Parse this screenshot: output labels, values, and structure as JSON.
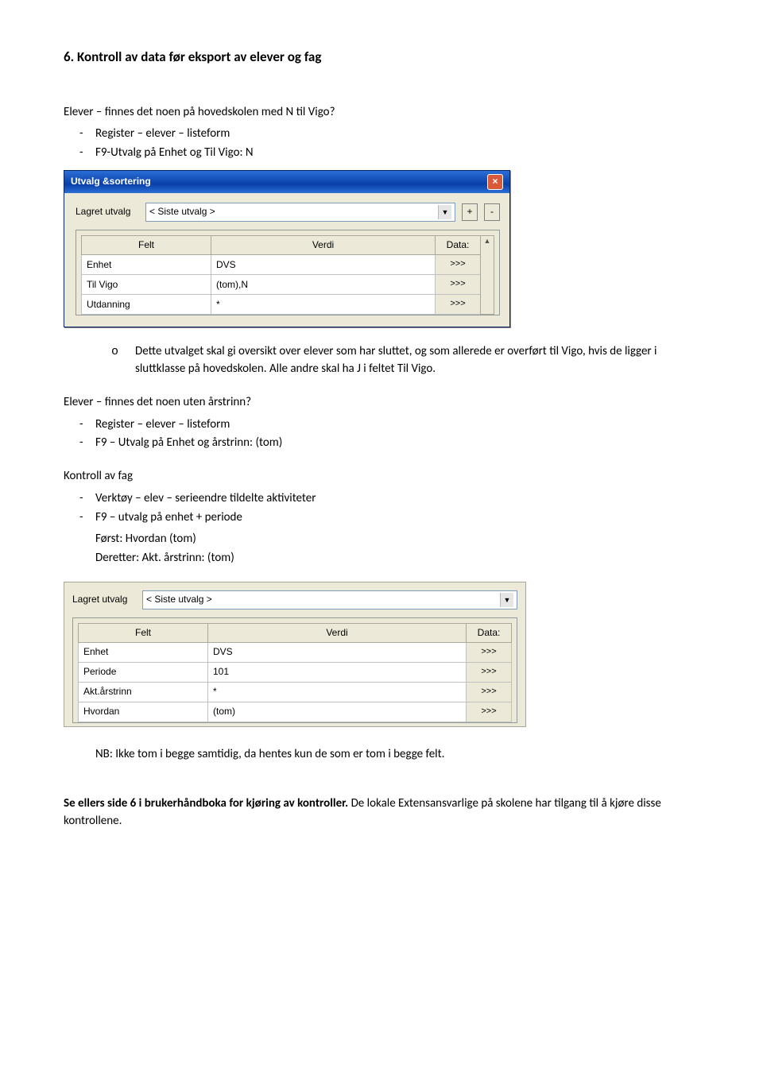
{
  "heading": "6. Kontroll av data før eksport av elever og fag",
  "sec1": {
    "intro": "Elever – finnes det noen på hovedskolen med N til Vigo?",
    "b1": "Register – elever – listeform",
    "b2": "F9-Utvalg på Enhet og Til Vigo: N",
    "sub": "Dette utvalget skal gi oversikt over elever som har sluttet, og som allerede er overført til Vigo, hvis de ligger i sluttklasse på hovedskolen. Alle andre skal ha J i feltet Til Vigo."
  },
  "dlg1": {
    "title": "Utvalg &sortering",
    "close": "×",
    "lagret_label": "Lagret utvalg",
    "lagret_value": "< Siste utvalg >",
    "plus": "+",
    "minus": "-",
    "cols": {
      "felt": "Felt",
      "verdi": "Verdi",
      "data": "Data:"
    },
    "angles": ">>>",
    "rows": [
      {
        "felt": "Enhet",
        "verdi": "DVS"
      },
      {
        "felt": "Til Vigo",
        "verdi": "(tom),N"
      },
      {
        "felt": "Utdanning",
        "verdi": "*"
      }
    ],
    "scroll_up": "▲"
  },
  "sec2": {
    "intro": "Elever – finnes det noen uten årstrinn?",
    "b1": "Register – elever – listeform",
    "b2": "F9 – Utvalg på Enhet og årstrinn: (tom)"
  },
  "sec3": {
    "intro": "Kontroll av fag",
    "b1": "Verktøy – elev – serieendre tildelte aktiviteter",
    "b2": "F9 – utvalg på enhet + periode",
    "l1": "Først: Hvordan (tom)",
    "l2": "Deretter: Akt. årstrinn: (tom)"
  },
  "dlg2": {
    "lagret_label": "Lagret utvalg",
    "lagret_value": "< Siste utvalg >",
    "cols": {
      "felt": "Felt",
      "verdi": "Verdi",
      "data": "Data:"
    },
    "angles": ">>>",
    "rows": [
      {
        "felt": "Enhet",
        "verdi": "DVS"
      },
      {
        "felt": "Periode",
        "verdi": "101"
      },
      {
        "felt": "Akt.årstrinn",
        "verdi": "*"
      },
      {
        "felt": "Hvordan",
        "verdi": "(tom)"
      }
    ]
  },
  "nb": "NB: Ikke tom i begge samtidig, da hentes kun de som er tom i begge felt.",
  "footer": {
    "bold": "Se ellers side 6 i brukerhåndboka for kjøring av kontroller. ",
    "rest": "De lokale Extensansvarlige på skolene har tilgang til å kjøre disse kontrollene."
  }
}
